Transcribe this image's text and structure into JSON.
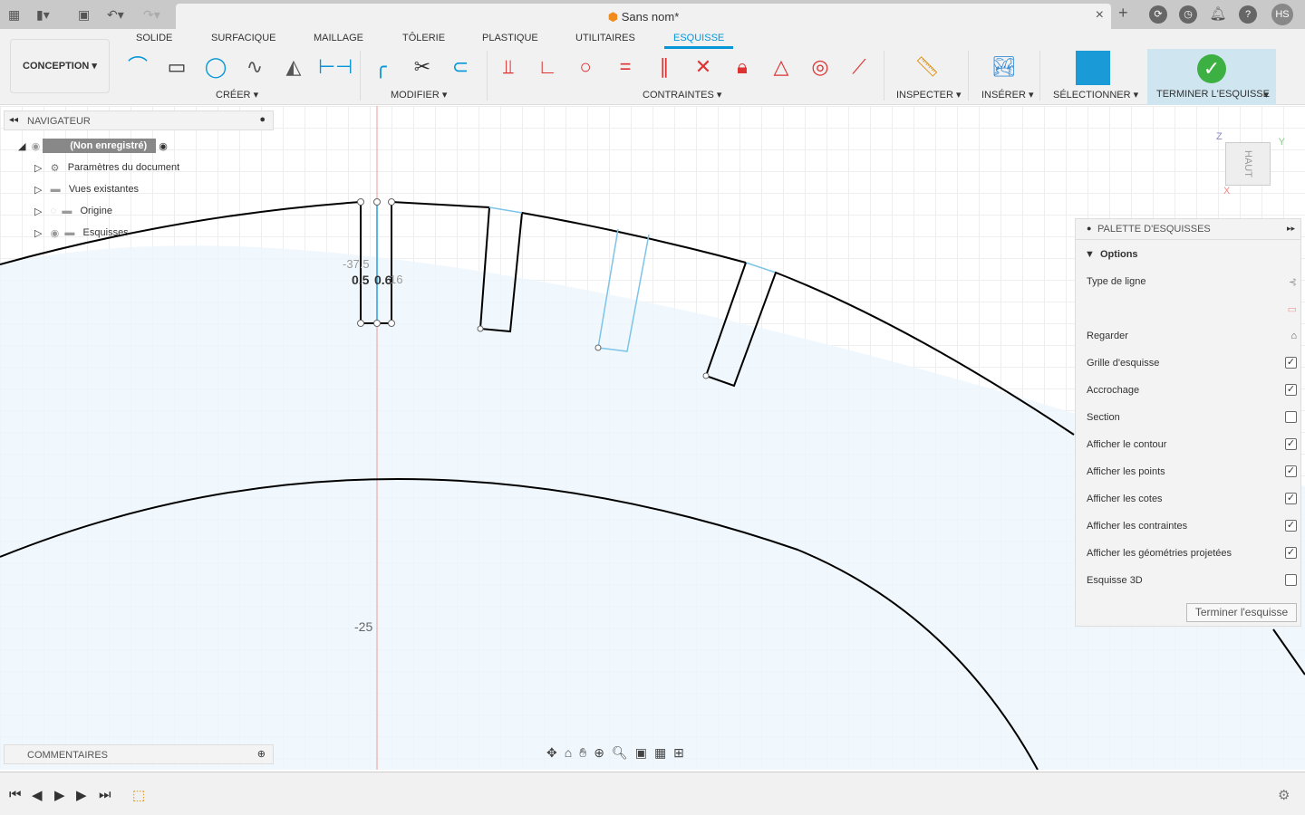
{
  "title": "Sans nom*",
  "user": "HS",
  "workspace": "CONCEPTION",
  "tabs": [
    "SOLIDE",
    "SURFACIQUE",
    "MAILLAGE",
    "TÔLERIE",
    "PLASTIQUE",
    "UTILITAIRES",
    "ESQUISSE"
  ],
  "groups": {
    "create": "CRÉER",
    "modify": "MODIFIER",
    "constraints": "CONTRAINTES",
    "inspect": "INSPECTER",
    "insert": "INSÉRER",
    "select": "SÉLECTIONNER",
    "finish": "TERMINER L'ESQUISSE"
  },
  "navigator": {
    "title": "NAVIGATEUR",
    "root": "(Non enregistré)",
    "items": [
      "Paramètres du document",
      "Vues existantes",
      "Origine",
      "Esquisses"
    ]
  },
  "comments": "COMMENTAIRES",
  "viewcube": {
    "face": "HAUT",
    "axes": [
      "Z",
      "Y",
      "X"
    ]
  },
  "sketch": {
    "dims": [
      "-37.5",
      "0.5",
      "0.6",
      "16"
    ],
    "axis_label": "-25"
  },
  "palette": {
    "title": "PALETTE D'ESQUISSES",
    "section": "Options",
    "rows": [
      {
        "label": "Type de ligne",
        "type": "icon"
      },
      {
        "label": "",
        "type": "icon"
      },
      {
        "label": "Regarder",
        "type": "icon"
      },
      {
        "label": "Grille d'esquisse",
        "checked": true
      },
      {
        "label": "Accrochage",
        "checked": true
      },
      {
        "label": "Section",
        "checked": false
      },
      {
        "label": "Afficher le contour",
        "checked": true
      },
      {
        "label": "Afficher les points",
        "checked": true
      },
      {
        "label": "Afficher les cotes",
        "checked": true
      },
      {
        "label": "Afficher les contraintes",
        "checked": true
      },
      {
        "label": "Afficher les géométries projetées",
        "checked": true
      },
      {
        "label": "Esquisse 3D",
        "checked": false
      }
    ],
    "finish_button": "Terminer l'esquisse"
  },
  "colors": {
    "accent": "#0696d7",
    "sketch_fill": "#eef6fc",
    "constraint": "#d33",
    "axis": "#e88"
  }
}
